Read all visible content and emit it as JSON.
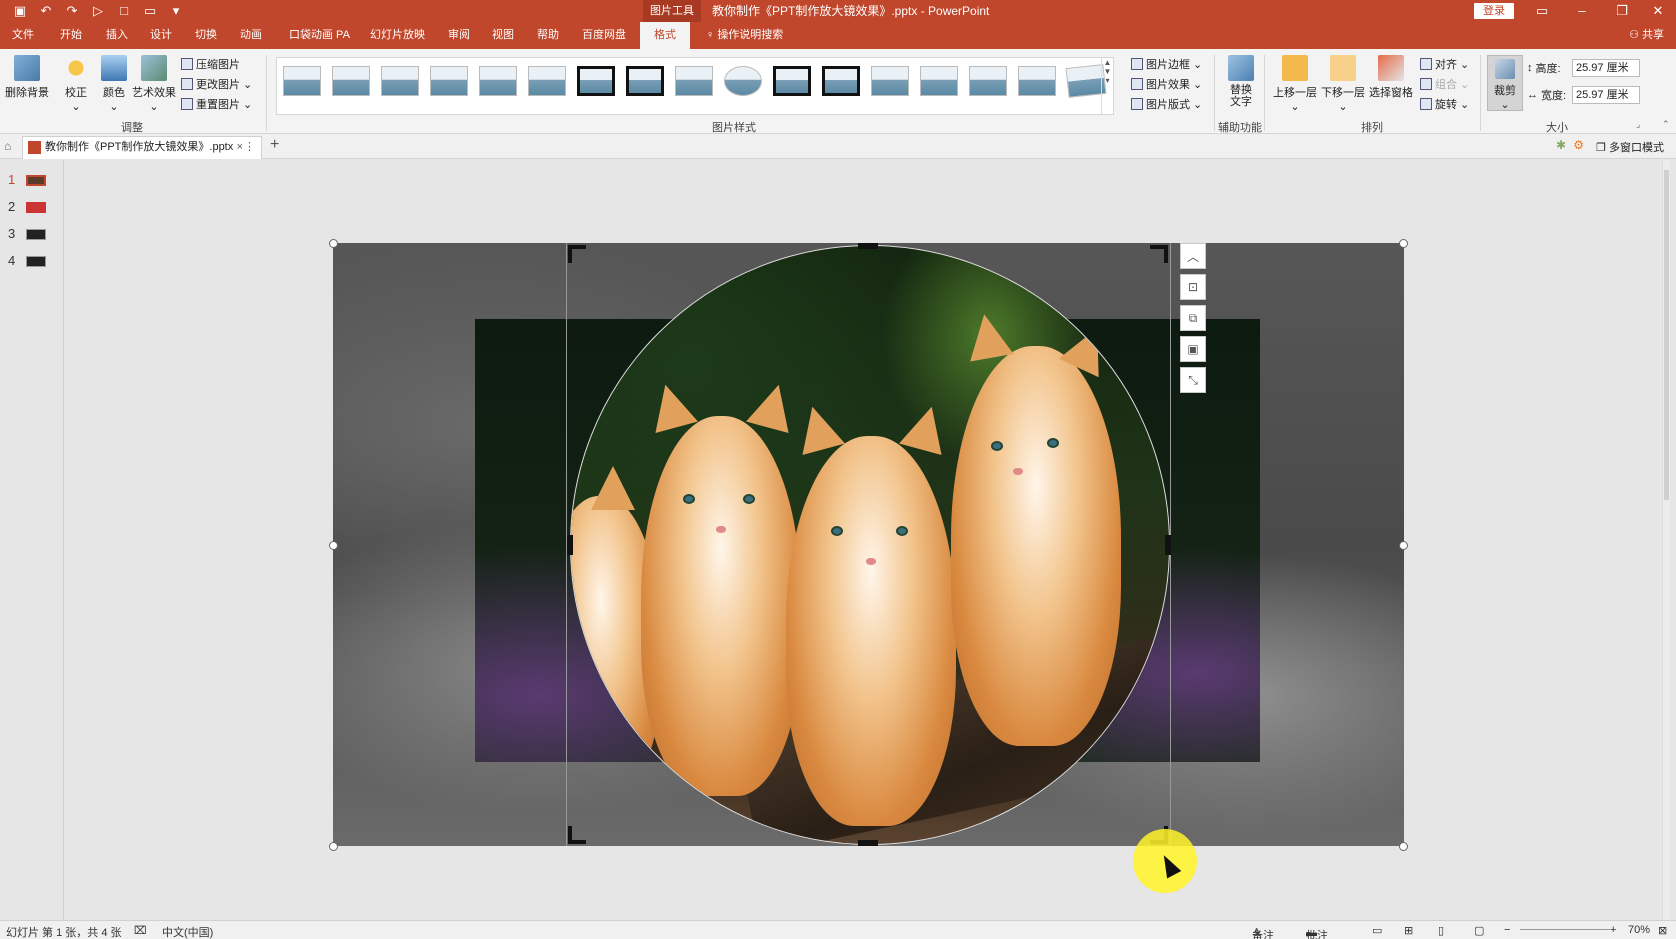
{
  "titlebar": {
    "context_tool": "图片工具",
    "document_title": "教你制作《PPT制作放大镜效果》.pptx - PowerPoint",
    "login_label": "登录",
    "qat_icons": [
      "save-icon",
      "undo-icon",
      "redo-icon",
      "from-beginning-icon",
      "new-icon",
      "open-icon",
      "customize-icon"
    ]
  },
  "tabs": [
    {
      "label": "文件"
    },
    {
      "label": "开始"
    },
    {
      "label": "插入"
    },
    {
      "label": "设计"
    },
    {
      "label": "切换"
    },
    {
      "label": "动画"
    },
    {
      "label": "口袋动画 PA"
    },
    {
      "label": "幻灯片放映"
    },
    {
      "label": "审阅"
    },
    {
      "label": "视图"
    },
    {
      "label": "帮助"
    },
    {
      "label": "百度网盘"
    },
    {
      "label": "格式"
    }
  ],
  "tell_me": "操作说明搜索",
  "share_label": "共享",
  "ribbon": {
    "adjust": {
      "remove_bg": "删除背景",
      "correct": "校正",
      "color": "颜色",
      "artistic": "艺术效果",
      "compress": "压缩图片",
      "change": "更改图片",
      "reset": "重置图片",
      "group_label": "调整"
    },
    "styles": {
      "border": "图片边框",
      "effects": "图片效果",
      "layout": "图片版式",
      "group_label": "图片样式"
    },
    "accessibility": {
      "alt_text": "替换\n文字",
      "group_label": "辅助功能"
    },
    "arrange": {
      "bring_forward": "上移一层",
      "send_backward": "下移一层",
      "selection_pane": "选择窗格",
      "align": "对齐",
      "group": "组合",
      "rotate": "旋转",
      "group_label": "排列"
    },
    "size": {
      "crop": "裁剪",
      "height_label": "高度:",
      "height_value": "25.97 厘米",
      "width_label": "宽度:",
      "width_value": "25.97 厘米",
      "group_label": "大小"
    }
  },
  "doctab": {
    "title": "教你制作《PPT制作放大镜效果》.pptx",
    "close": "×",
    "more": "⋮",
    "new_tab": "+",
    "multi_window": "多窗口模式"
  },
  "slides": [
    {
      "num": "1"
    },
    {
      "num": "2"
    },
    {
      "num": "3"
    },
    {
      "num": "4"
    }
  ],
  "statusbar": {
    "slide_info": "幻灯片 第 1 张，共 4 张",
    "language": "中文(中国)",
    "notes": "备注",
    "comments": "批注",
    "zoom": "70%"
  },
  "colors": {
    "accent": "#c0472c",
    "ribbon_bg": "#f3f3f3",
    "canvas_bg": "#e6e6e6"
  }
}
